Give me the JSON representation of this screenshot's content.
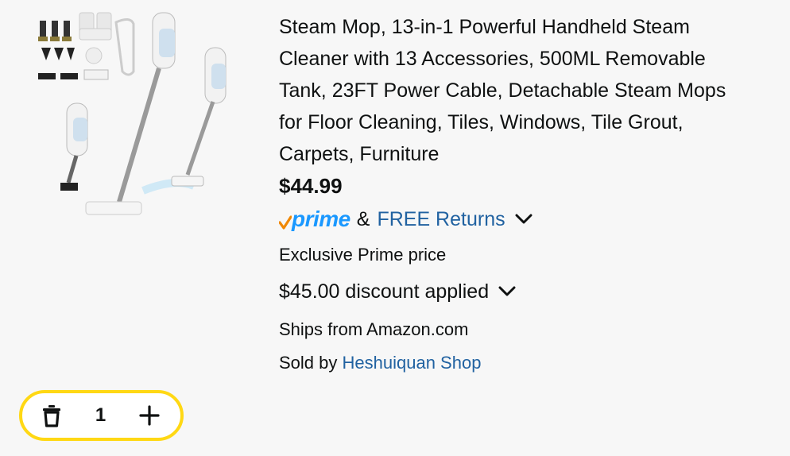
{
  "product": {
    "title_lines": [
      "Steam Mop, 13-in-1 Powerful Handheld Steam",
      "Cleaner with 13 Accessories, 500ML Removable",
      "Tank, 23FT Power Cable, Detachable Steam Mops",
      "for Floor Cleaning, Tiles, Windows, Tile Grout,",
      "Carpets, Furniture"
    ],
    "price": "$44.99",
    "prime_label": "prime",
    "amp": "&",
    "free_returns": "FREE Returns",
    "exclusive_text": "Exclusive Prime price",
    "discount_text": "$45.00 discount applied",
    "ships_from": "Ships from Amazon.com",
    "sold_by_prefix": "Sold by",
    "seller_name": "Heshuiquan Shop"
  },
  "cart": {
    "quantity": "1"
  },
  "colors": {
    "prime_blue": "#1a98ff",
    "prime_check": "#f08804",
    "link_blue": "#2162a1",
    "qty_border": "#ffd814"
  },
  "icons": {
    "delete": "trash-icon",
    "increase": "plus-icon",
    "expand": "chevron-down-icon",
    "prime_check": "prime-check-icon"
  }
}
